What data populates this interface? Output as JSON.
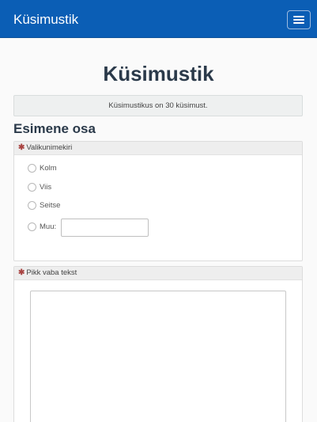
{
  "navbar": {
    "brand": "Küsimustik",
    "menu_icon": "hamburger-menu-icon"
  },
  "page": {
    "title": "Küsimustik",
    "info": "Küsimustikus on 30 küsimust."
  },
  "section": {
    "title": "Esimene osa"
  },
  "questions": [
    {
      "required_marker": "✱",
      "label": "Valikunimekiri",
      "options": [
        "Kolm",
        "Viis",
        "Seitse",
        "Muu:"
      ],
      "other_value": ""
    },
    {
      "required_marker": "✱",
      "label": "Pikk vaba tekst",
      "value": ""
    }
  ],
  "colors": {
    "navbar": "#0b5eb5",
    "required": "#a94442",
    "panel_header": "#eeeeee"
  }
}
